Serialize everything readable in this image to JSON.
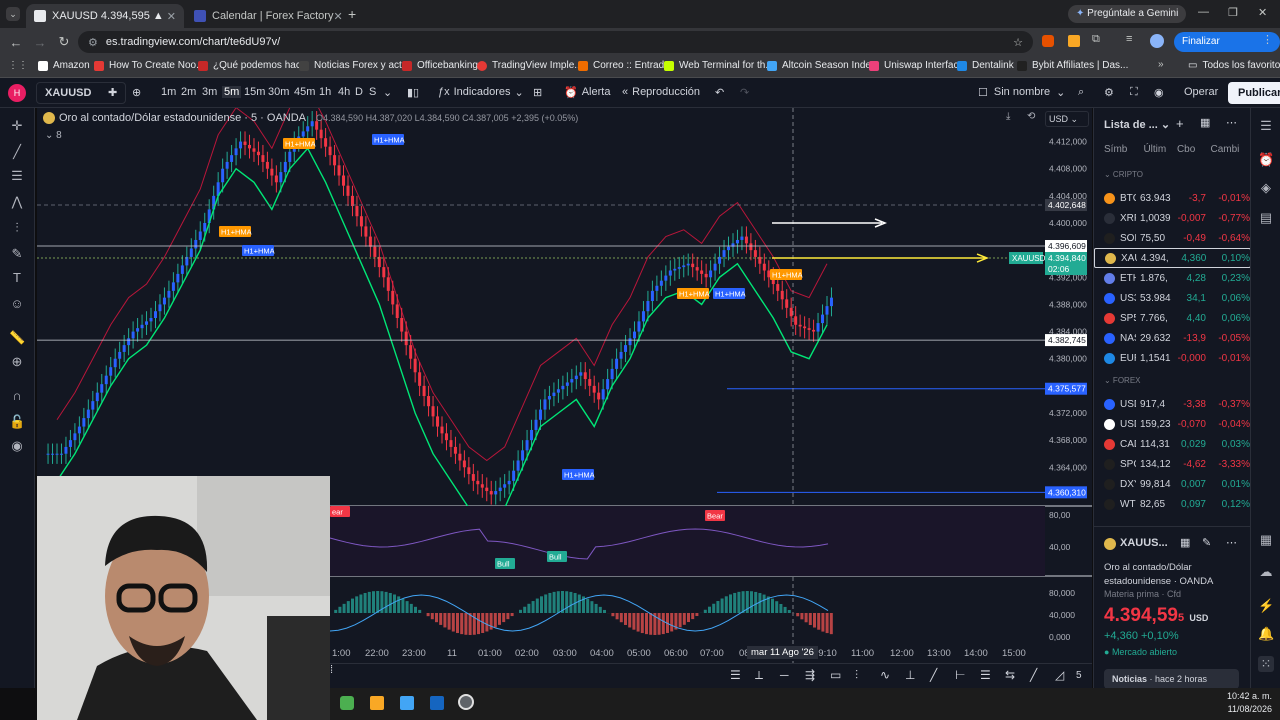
{
  "browser": {
    "tabs": [
      {
        "label": "XAUUSD 4.394,595 ▲ +0.1% Si",
        "active": true
      },
      {
        "label": "Calendar | Forex Factory",
        "active": false
      }
    ],
    "gemini_label": "Pregúntale a Gemini",
    "url": "es.tradingview.com/chart/te6dU97v/",
    "update_button": "Finalizar actualización",
    "bookmarks": [
      "Amazon",
      "How To Create Noo...",
      "¿Qué podemos hac...",
      "Noticias Forex y act...",
      "Officebanking",
      "TradingView Imple...",
      "Correo :: Entrada",
      "Web Terminal for th...",
      "Altcoin Season Inde...",
      "Uniswap Interface",
      "Dentalink",
      "Bybit Affiliates | Das..."
    ],
    "all_favorites": "Todos los favoritos"
  },
  "toolbar": {
    "symbol": "XAUUSD",
    "intervals": [
      "1m",
      "2m",
      "3m",
      "5m",
      "15m",
      "30m",
      "45m",
      "1h",
      "4h",
      "D",
      "S"
    ],
    "active_interval": "5m",
    "indicators": "Indicadores",
    "alert": "Alerta",
    "replay": "Reproducción",
    "layout_name": "Sin nombre",
    "trade": "Operar",
    "publish": "Publicar"
  },
  "chart": {
    "title": "Oro al contado/Dólar estadounidense · 5 · OANDA",
    "ohlc": "O4.384,590 H4.387,020 L4.384,590 C4.387,005 +2,395 (+0.05%)",
    "indicator_count": "8",
    "currency": "USD",
    "price_axis": [
      "4.412,000",
      "4.408,000",
      "4.404,000",
      "4.400,000",
      "4.392,000",
      "4.388,000",
      "4.384,000",
      "4.380,000",
      "4.372,000",
      "4.368,000",
      "4.364,000"
    ],
    "price_tags": {
      "crosshair": "4.402,648",
      "level_high": "4.396,609",
      "symbol_tag": "XAUUSD",
      "current": "4.394,840",
      "countdown": "02:06",
      "level_low": "4.382,745",
      "blue1": "4.375,577",
      "blue2": "4.360,310"
    },
    "labels": [
      "H1+HMA",
      "H1+HMA",
      "H1+HMA",
      "H1+HMA",
      "H1+HMA",
      "H1+HMA",
      "H1+HMA",
      "H1+HMA",
      "H1+HMA"
    ],
    "osc_axis": [
      "80,00",
      "40,00"
    ],
    "osc2_axis": [
      "80,000",
      "40,000",
      "0,000"
    ],
    "osc_labels": {
      "bear": "Bear",
      "bull": "Bull",
      "bear_cut": "ear"
    },
    "time_axis": [
      "1:00",
      "22:00",
      "23:00",
      "11",
      "01:00",
      "02:00",
      "03:00",
      "04:00",
      "05:00",
      "06:00",
      "07:00",
      "08",
      "09:10",
      "11:00",
      "12:00",
      "13:00",
      "14:00",
      "15:00"
    ],
    "crosshair_date": "mar 11 Ago '26",
    "bottom_count": "5",
    "series": {
      "price_path": "scaled",
      "note_ohlc": "candles"
    }
  },
  "watchlist": {
    "title": "Lista de ...",
    "columns": [
      "Símb",
      "Últim",
      "Cbo",
      "Cambi"
    ],
    "sections": [
      {
        "name": "CRIPTO",
        "rows": [
          {
            "sym": "BTC",
            "last": "63.943",
            "chg": "-3,7",
            "pct": "-0,01%",
            "color": "#f7931a",
            "dir": "red"
          },
          {
            "sym": "XRP",
            "last": "1,0039",
            "chg": "-0,007",
            "pct": "-0,77%",
            "color": "#2a2e39",
            "dir": "red"
          },
          {
            "sym": "SOL",
            "last": "75,50",
            "chg": "-0,49",
            "pct": "-0,64%",
            "color": "#1f1f1f",
            "dir": "red"
          },
          {
            "sym": "XAU",
            "last": "4.394,",
            "chg": "4,360",
            "pct": "0,10%",
            "color": "#e0b84c",
            "dir": "green"
          },
          {
            "sym": "ETH",
            "last": "1.876,",
            "chg": "4,28",
            "pct": "0,23%",
            "color": "#627eea",
            "dir": "green"
          },
          {
            "sym": "US3",
            "last": "53.984",
            "chg": "34,1",
            "pct": "0,06%",
            "color": "#2962ff",
            "dir": "green"
          },
          {
            "sym": "SP5",
            "last": "7.766,",
            "chg": "4,40",
            "pct": "0,06%",
            "color": "#e53935",
            "dir": "green"
          },
          {
            "sym": "NAS",
            "last": "29.632",
            "chg": "-13,9",
            "pct": "-0,05%",
            "color": "#2962ff",
            "dir": "red"
          },
          {
            "sym": "EUR",
            "last": "1,1541",
            "chg": "-0,000",
            "pct": "-0,01%",
            "color": "#1e88e5",
            "dir": "red"
          }
        ]
      },
      {
        "name": "FOREX",
        "rows": [
          {
            "sym": "USD",
            "last": "917,4",
            "chg": "-3,38",
            "pct": "-0,37%",
            "color": "#2962ff",
            "dir": "red"
          },
          {
            "sym": "USD",
            "last": "159,23",
            "chg": "-0,070",
            "pct": "-0,04%",
            "color": "#ffffff",
            "dir": "red"
          },
          {
            "sym": "CAD",
            "last": "114,31",
            "chg": "0,029",
            "pct": "0,03%",
            "color": "#e53935",
            "dir": "green"
          },
          {
            "sym": "SPC",
            "last": "134,12",
            "chg": "-4,62",
            "pct": "-3,33%",
            "color": "#1f1f1f",
            "dir": "red"
          },
          {
            "sym": "DXY",
            "last": "99,814",
            "chg": "0,007",
            "pct": "0,01%",
            "color": "#1f1f1f",
            "dir": "green"
          },
          {
            "sym": "WTI",
            "last": "82,65",
            "chg": "0,097",
            "pct": "0,12%",
            "color": "#1f1f1f",
            "dir": "green"
          }
        ]
      }
    ],
    "detail": {
      "symbol": "XAUUS...",
      "name": "Oro al contado/Dólar estadounidense",
      "exchange": "OANDA",
      "category": "Materia prima · Cfd",
      "price": "4.394,59",
      "price_small": "5",
      "currency": "USD",
      "change": "+4,360  +0,10%",
      "status": "Mercado abierto",
      "news": "Noticias",
      "news_time": "hace 2 horas"
    }
  },
  "taskbar": {
    "time": "10:42 a. m.",
    "date": "11/08/2026"
  },
  "colors": {
    "accent": "#2962ff",
    "up": "#22ab94",
    "down": "#f23645",
    "bg": "#131722"
  }
}
